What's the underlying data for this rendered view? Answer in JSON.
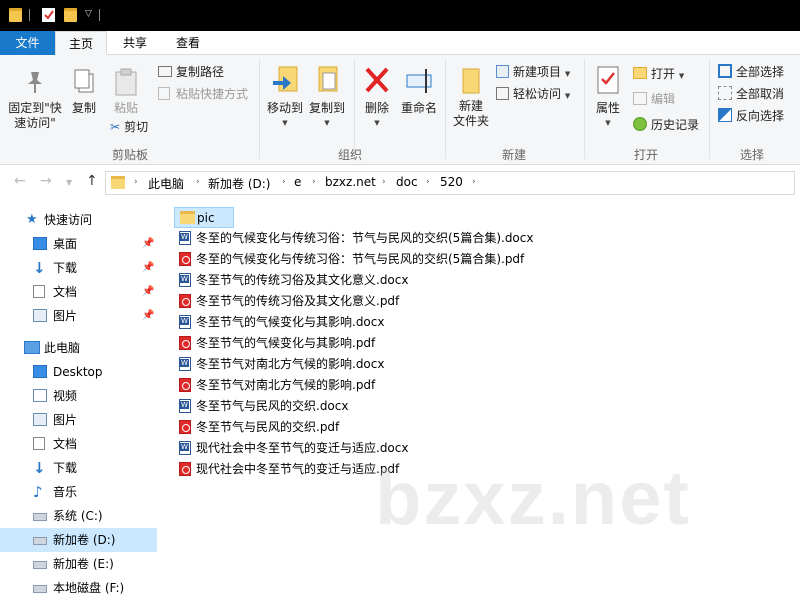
{
  "ribbon_tabs": {
    "file": "文件",
    "home": "主页",
    "share": "共享",
    "view": "查看"
  },
  "clipboard": {
    "pin_label_1": "固定到\"快",
    "pin_label_2": "速访问\"",
    "copy": "复制",
    "paste": "粘贴",
    "copy_path": "复制路径",
    "paste_shortcut": "粘贴快捷方式",
    "cut": "剪切",
    "group": "剪贴板"
  },
  "organize": {
    "move_to": "移动到",
    "copy_to": "复制到",
    "delete": "删除",
    "rename": "重命名",
    "group": "组织"
  },
  "new": {
    "new_folder_1": "新建",
    "new_folder_2": "文件夹",
    "new_item": "新建项目",
    "easy_access": "轻松访问",
    "group": "新建"
  },
  "open": {
    "properties": "属性",
    "open": "打开",
    "edit": "编辑",
    "history": "历史记录",
    "group": "打开"
  },
  "select": {
    "select_all": "全部选择",
    "select_none": "全部取消",
    "invert": "反向选择",
    "group": "选择"
  },
  "breadcrumb": [
    "此电脑",
    "新加卷 (D:)",
    "e",
    "bzxz.net",
    "doc",
    "520"
  ],
  "sidebar": {
    "quick_access": "快速访问",
    "quick_items": [
      "桌面",
      "下载",
      "文档",
      "图片"
    ],
    "this_pc": "此电脑",
    "pc_items": [
      "Desktop",
      "视频",
      "图片",
      "文档",
      "下载",
      "音乐",
      "系统 (C:)",
      "新加卷 (D:)",
      "新加卷 (E:)",
      "本地磁盘 (F:)"
    ]
  },
  "files": [
    {
      "name": "pic",
      "type": "folder"
    },
    {
      "name": "冬至的气候变化与传统习俗：节气与民风的交织(5篇合集).docx",
      "type": "docx"
    },
    {
      "name": "冬至的气候变化与传统习俗：节气与民风的交织(5篇合集).pdf",
      "type": "pdf"
    },
    {
      "name": "冬至节气的传统习俗及其文化意义.docx",
      "type": "docx"
    },
    {
      "name": "冬至节气的传统习俗及其文化意义.pdf",
      "type": "pdf"
    },
    {
      "name": "冬至节气的气候变化与其影响.docx",
      "type": "docx"
    },
    {
      "name": "冬至节气的气候变化与其影响.pdf",
      "type": "pdf"
    },
    {
      "name": "冬至节气对南北方气候的影响.docx",
      "type": "docx"
    },
    {
      "name": "冬至节气对南北方气候的影响.pdf",
      "type": "pdf"
    },
    {
      "name": "冬至节气与民风的交织.docx",
      "type": "docx"
    },
    {
      "name": "冬至节气与民风的交织.pdf",
      "type": "pdf"
    },
    {
      "name": "现代社会中冬至节气的变迁与适应.docx",
      "type": "docx"
    },
    {
      "name": "现代社会中冬至节气的变迁与适应.pdf",
      "type": "pdf"
    }
  ],
  "watermark": "bzxz.net"
}
